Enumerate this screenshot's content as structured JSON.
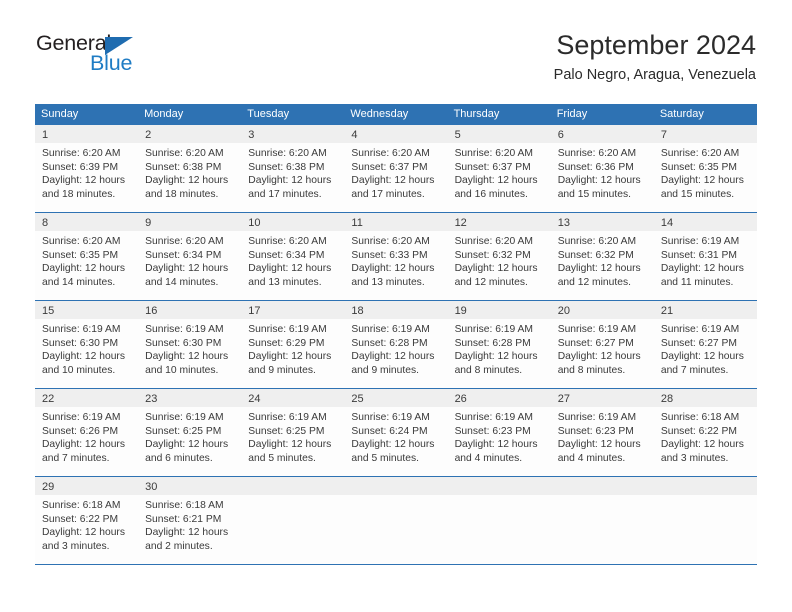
{
  "brand": {
    "name_part1": "General",
    "name_part2": "Blue",
    "triangle_color": "#1f6cb0",
    "blue_color": "#1f7cc4"
  },
  "header": {
    "title": "September 2024",
    "subtitle": "Palo Negro, Aragua, Venezuela"
  },
  "theme": {
    "header_blue": "#2e72b3",
    "daynum_band": "#efefef",
    "cell_background": "#fdfdfd",
    "text_color": "#3a3a3a"
  },
  "weekdays": [
    "Sunday",
    "Monday",
    "Tuesday",
    "Wednesday",
    "Thursday",
    "Friday",
    "Saturday"
  ],
  "weeks": [
    {
      "days": [
        {
          "num": "1",
          "sunrise": "Sunrise: 6:20 AM",
          "sunset": "Sunset: 6:39 PM",
          "daylight1": "Daylight: 12 hours",
          "daylight2": "and 18 minutes."
        },
        {
          "num": "2",
          "sunrise": "Sunrise: 6:20 AM",
          "sunset": "Sunset: 6:38 PM",
          "daylight1": "Daylight: 12 hours",
          "daylight2": "and 18 minutes."
        },
        {
          "num": "3",
          "sunrise": "Sunrise: 6:20 AM",
          "sunset": "Sunset: 6:38 PM",
          "daylight1": "Daylight: 12 hours",
          "daylight2": "and 17 minutes."
        },
        {
          "num": "4",
          "sunrise": "Sunrise: 6:20 AM",
          "sunset": "Sunset: 6:37 PM",
          "daylight1": "Daylight: 12 hours",
          "daylight2": "and 17 minutes."
        },
        {
          "num": "5",
          "sunrise": "Sunrise: 6:20 AM",
          "sunset": "Sunset: 6:37 PM",
          "daylight1": "Daylight: 12 hours",
          "daylight2": "and 16 minutes."
        },
        {
          "num": "6",
          "sunrise": "Sunrise: 6:20 AM",
          "sunset": "Sunset: 6:36 PM",
          "daylight1": "Daylight: 12 hours",
          "daylight2": "and 15 minutes."
        },
        {
          "num": "7",
          "sunrise": "Sunrise: 6:20 AM",
          "sunset": "Sunset: 6:35 PM",
          "daylight1": "Daylight: 12 hours",
          "daylight2": "and 15 minutes."
        }
      ]
    },
    {
      "days": [
        {
          "num": "8",
          "sunrise": "Sunrise: 6:20 AM",
          "sunset": "Sunset: 6:35 PM",
          "daylight1": "Daylight: 12 hours",
          "daylight2": "and 14 minutes."
        },
        {
          "num": "9",
          "sunrise": "Sunrise: 6:20 AM",
          "sunset": "Sunset: 6:34 PM",
          "daylight1": "Daylight: 12 hours",
          "daylight2": "and 14 minutes."
        },
        {
          "num": "10",
          "sunrise": "Sunrise: 6:20 AM",
          "sunset": "Sunset: 6:34 PM",
          "daylight1": "Daylight: 12 hours",
          "daylight2": "and 13 minutes."
        },
        {
          "num": "11",
          "sunrise": "Sunrise: 6:20 AM",
          "sunset": "Sunset: 6:33 PM",
          "daylight1": "Daylight: 12 hours",
          "daylight2": "and 13 minutes."
        },
        {
          "num": "12",
          "sunrise": "Sunrise: 6:20 AM",
          "sunset": "Sunset: 6:32 PM",
          "daylight1": "Daylight: 12 hours",
          "daylight2": "and 12 minutes."
        },
        {
          "num": "13",
          "sunrise": "Sunrise: 6:20 AM",
          "sunset": "Sunset: 6:32 PM",
          "daylight1": "Daylight: 12 hours",
          "daylight2": "and 12 minutes."
        },
        {
          "num": "14",
          "sunrise": "Sunrise: 6:19 AM",
          "sunset": "Sunset: 6:31 PM",
          "daylight1": "Daylight: 12 hours",
          "daylight2": "and 11 minutes."
        }
      ]
    },
    {
      "days": [
        {
          "num": "15",
          "sunrise": "Sunrise: 6:19 AM",
          "sunset": "Sunset: 6:30 PM",
          "daylight1": "Daylight: 12 hours",
          "daylight2": "and 10 minutes."
        },
        {
          "num": "16",
          "sunrise": "Sunrise: 6:19 AM",
          "sunset": "Sunset: 6:30 PM",
          "daylight1": "Daylight: 12 hours",
          "daylight2": "and 10 minutes."
        },
        {
          "num": "17",
          "sunrise": "Sunrise: 6:19 AM",
          "sunset": "Sunset: 6:29 PM",
          "daylight1": "Daylight: 12 hours",
          "daylight2": "and 9 minutes."
        },
        {
          "num": "18",
          "sunrise": "Sunrise: 6:19 AM",
          "sunset": "Sunset: 6:28 PM",
          "daylight1": "Daylight: 12 hours",
          "daylight2": "and 9 minutes."
        },
        {
          "num": "19",
          "sunrise": "Sunrise: 6:19 AM",
          "sunset": "Sunset: 6:28 PM",
          "daylight1": "Daylight: 12 hours",
          "daylight2": "and 8 minutes."
        },
        {
          "num": "20",
          "sunrise": "Sunrise: 6:19 AM",
          "sunset": "Sunset: 6:27 PM",
          "daylight1": "Daylight: 12 hours",
          "daylight2": "and 8 minutes."
        },
        {
          "num": "21",
          "sunrise": "Sunrise: 6:19 AM",
          "sunset": "Sunset: 6:27 PM",
          "daylight1": "Daylight: 12 hours",
          "daylight2": "and 7 minutes."
        }
      ]
    },
    {
      "days": [
        {
          "num": "22",
          "sunrise": "Sunrise: 6:19 AM",
          "sunset": "Sunset: 6:26 PM",
          "daylight1": "Daylight: 12 hours",
          "daylight2": "and 7 minutes."
        },
        {
          "num": "23",
          "sunrise": "Sunrise: 6:19 AM",
          "sunset": "Sunset: 6:25 PM",
          "daylight1": "Daylight: 12 hours",
          "daylight2": "and 6 minutes."
        },
        {
          "num": "24",
          "sunrise": "Sunrise: 6:19 AM",
          "sunset": "Sunset: 6:25 PM",
          "daylight1": "Daylight: 12 hours",
          "daylight2": "and 5 minutes."
        },
        {
          "num": "25",
          "sunrise": "Sunrise: 6:19 AM",
          "sunset": "Sunset: 6:24 PM",
          "daylight1": "Daylight: 12 hours",
          "daylight2": "and 5 minutes."
        },
        {
          "num": "26",
          "sunrise": "Sunrise: 6:19 AM",
          "sunset": "Sunset: 6:23 PM",
          "daylight1": "Daylight: 12 hours",
          "daylight2": "and 4 minutes."
        },
        {
          "num": "27",
          "sunrise": "Sunrise: 6:19 AM",
          "sunset": "Sunset: 6:23 PM",
          "daylight1": "Daylight: 12 hours",
          "daylight2": "and 4 minutes."
        },
        {
          "num": "28",
          "sunrise": "Sunrise: 6:18 AM",
          "sunset": "Sunset: 6:22 PM",
          "daylight1": "Daylight: 12 hours",
          "daylight2": "and 3 minutes."
        }
      ]
    },
    {
      "days": [
        {
          "num": "29",
          "sunrise": "Sunrise: 6:18 AM",
          "sunset": "Sunset: 6:22 PM",
          "daylight1": "Daylight: 12 hours",
          "daylight2": "and 3 minutes."
        },
        {
          "num": "30",
          "sunrise": "Sunrise: 6:18 AM",
          "sunset": "Sunset: 6:21 PM",
          "daylight1": "Daylight: 12 hours",
          "daylight2": "and 2 minutes."
        },
        {
          "num": "",
          "sunrise": "",
          "sunset": "",
          "daylight1": "",
          "daylight2": ""
        },
        {
          "num": "",
          "sunrise": "",
          "sunset": "",
          "daylight1": "",
          "daylight2": ""
        },
        {
          "num": "",
          "sunrise": "",
          "sunset": "",
          "daylight1": "",
          "daylight2": ""
        },
        {
          "num": "",
          "sunrise": "",
          "sunset": "",
          "daylight1": "",
          "daylight2": ""
        },
        {
          "num": "",
          "sunrise": "",
          "sunset": "",
          "daylight1": "",
          "daylight2": ""
        }
      ]
    }
  ]
}
